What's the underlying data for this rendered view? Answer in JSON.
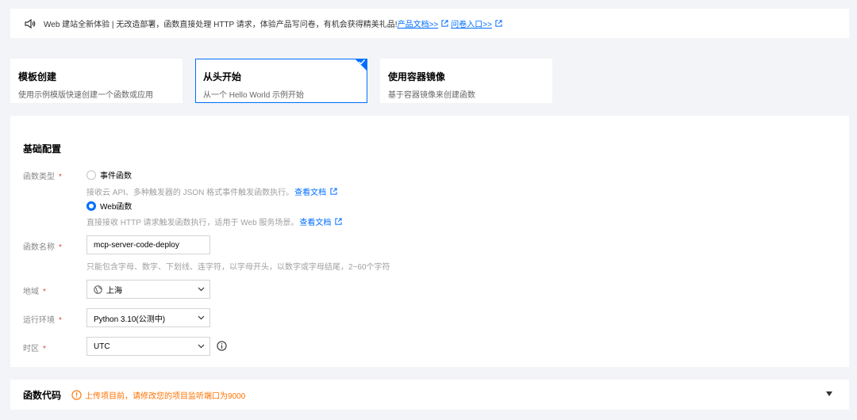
{
  "notice": {
    "text": "Web 建站全新体验 | 无改造部署，函数直接处理 HTTP 请求，体验产品写问卷，有机会获得精美礼品!",
    "docs_link": "产品文档>>",
    "survey_link": "问卷入口>>"
  },
  "creation_methods": [
    {
      "title": "模板创建",
      "desc": "使用示例模版快速创建一个函数或应用"
    },
    {
      "title": "从头开始",
      "desc": "从一个 Hello World 示例开始",
      "selected": true
    },
    {
      "title": "使用容器镜像",
      "desc": "基于容器镜像来创建函数"
    }
  ],
  "basic_config": {
    "title": "基础配置",
    "function_type": {
      "label": "函数类型",
      "options": [
        {
          "label": "事件函数",
          "help": "接收云 API、多种触发器的 JSON 格式事件触发函数执行。",
          "link": "查看文档"
        },
        {
          "label": "Web函数",
          "help": "直接接收 HTTP 请求触发函数执行，适用于 Web 服务场景。",
          "link": "查看文档",
          "checked": true
        }
      ]
    },
    "function_name": {
      "label": "函数名称",
      "value": "mcp-server-code-deploy",
      "help": "只能包含字母、数字、下划线、连字符，以字母开头，以数字或字母结尾，2~60个字符"
    },
    "region": {
      "label": "地域",
      "value": "上海"
    },
    "runtime": {
      "label": "运行环境",
      "value": "Python 3.10(公测中)"
    },
    "timezone": {
      "label": "时区",
      "value": "UTC"
    },
    "required_mark": "*"
  },
  "function_code": {
    "title": "函数代码",
    "warning": "上传项目前，请修改您的项目监听端口为9000"
  },
  "colors": {
    "accent": "#006eff",
    "warning": "#ff7200",
    "required": "#e54545"
  }
}
